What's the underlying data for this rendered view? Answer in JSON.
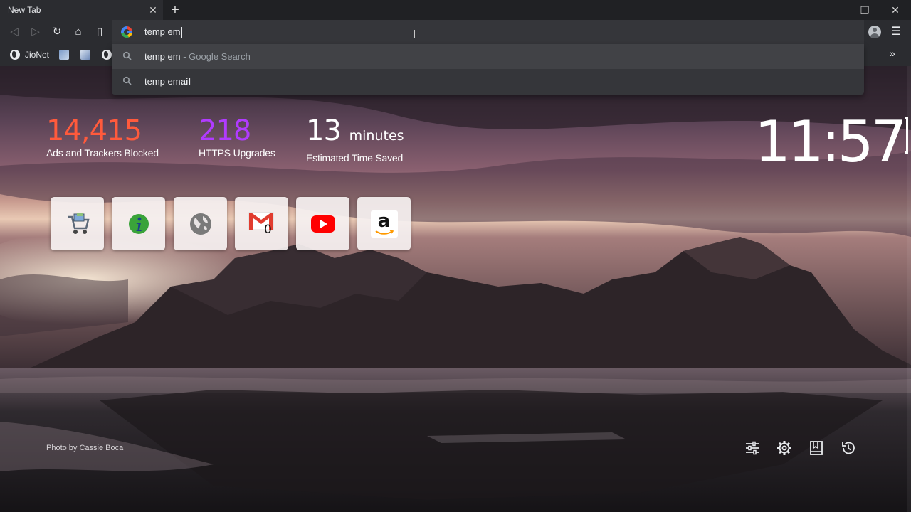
{
  "tab": {
    "title": "New Tab",
    "close_glyph": "✕",
    "new_tab_glyph": "+"
  },
  "window_controls": {
    "minimize": "—",
    "restore": "❐",
    "close": "✕"
  },
  "toolbar": {
    "back_glyph": "◁",
    "forward_glyph": "▷",
    "reload_glyph": "↻",
    "home_glyph": "⌂",
    "bookmark_glyph": "▯",
    "omnibox_text": "temp em",
    "menu_glyph": "☰"
  },
  "bookmarks": {
    "items": [
      {
        "label": "JioNet",
        "icon": "globe-icon"
      }
    ],
    "more_glyph": "»"
  },
  "suggestions": [
    {
      "query": "temp em",
      "suffix": " - Google Search",
      "icon": "search-icon"
    },
    {
      "prefix": "temp em",
      "completion": "ail",
      "icon": "search-icon"
    }
  ],
  "stats": {
    "ads": {
      "value": "14,415",
      "label": "Ads and Trackers Blocked",
      "color": "#ff5a3c"
    },
    "https": {
      "value": "218",
      "label": "HTTPS Upgrades",
      "color": "#b13bff"
    },
    "time": {
      "value": "13",
      "unit": "minutes",
      "label": "Estimated Time Saved",
      "color": "#ffffff"
    }
  },
  "clock": {
    "time": "11:57"
  },
  "top_sites": [
    {
      "name": "shopping-cart-site",
      "icon": "cart-icon"
    },
    {
      "name": "info-site",
      "icon": "info-icon"
    },
    {
      "name": "globe-site",
      "icon": "globe-icon"
    },
    {
      "name": "gmail-site",
      "icon": "gmail-icon",
      "badge": "0"
    },
    {
      "name": "youtube-site",
      "icon": "youtube-icon"
    },
    {
      "name": "amazon-site",
      "icon": "amazon-icon",
      "letter": "a"
    }
  ],
  "photo_credit": "Photo by Cassie Boca",
  "footer_controls": [
    "sliders-icon",
    "gear-icon",
    "bookmarks-icon",
    "history-icon"
  ]
}
